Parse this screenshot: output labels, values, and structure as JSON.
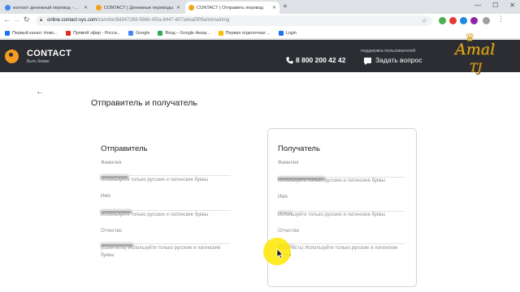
{
  "browser": {
    "tabs": [
      {
        "label": "контакт денежный перевод - Пои",
        "active": false
      },
      {
        "label": "CONTACT | Денежные переводы",
        "active": false
      },
      {
        "label": "CONTACT | Отправить перевод",
        "active": true
      }
    ],
    "url_host": "online.contact-sys.com",
    "url_path": "/transfer/8d847269-566b-45fa-8447-607a6ea5f06a/remaining",
    "bookmarks": [
      "Первый канал: Ново...",
      "Прямой эфир - Росси...",
      "Google",
      "Вход – Google Аккау...",
      "Первая отделочная ...",
      "Login"
    ],
    "bookmark_colors": [
      "#1a73e8",
      "#d93025",
      "#4285f4",
      "#34a853",
      "#fbbc04",
      "#1a73e8"
    ]
  },
  "site": {
    "logo_text": "CONTACT",
    "logo_tagline": "Быть ближе",
    "phone": "8 800 200 42 42",
    "support_caption": "поддержка пользователей",
    "ask_label": "Задать вопрос",
    "brand_color": "#f39c1f",
    "header_bg": "#2b2d33"
  },
  "watermark": {
    "line1": "Amal",
    "line2": "TJ"
  },
  "page": {
    "title": "Отправитель и получатель",
    "sender": {
      "title": "Отправитель",
      "surname_label": "Фамилия",
      "surname_hint": "Используйте только русские и латинские буквы",
      "name_label": "Имя",
      "name_hint": "Используйте только русские и латинские буквы",
      "patronymic_label": "Отчество",
      "patronymic_hint": "(Если есть) Используйте только русские и латинские буквы"
    },
    "recipient": {
      "title": "Получатель",
      "surname_label": "Фамилия",
      "surname_hint": "Используйте только русские и латинские буквы",
      "name_label": "Имя",
      "name_hint": "Используйте только русские и латинские буквы",
      "patronymic_label": "Отчество",
      "patronymic_hint": "(Если есть) Используйте только русские и латинские буквы"
    }
  }
}
